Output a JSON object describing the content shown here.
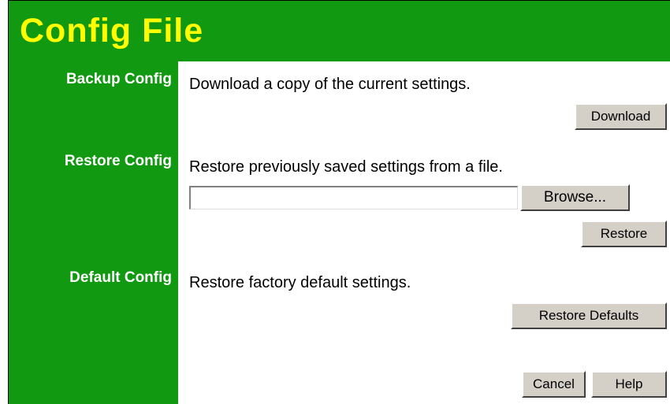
{
  "header": {
    "title": "Config File"
  },
  "sections": {
    "backup": {
      "label": "Backup Config",
      "description": "Download a copy of the current settings.",
      "button_label": "Download"
    },
    "restore": {
      "label": "Restore Config",
      "description": "Restore previously saved settings from a file.",
      "file_value": "",
      "browse_label": "Browse...",
      "button_label": "Restore"
    },
    "default": {
      "label": "Default Config",
      "description": "Restore factory default settings.",
      "button_label": "Restore Defaults"
    }
  },
  "footer": {
    "cancel_label": "Cancel",
    "help_label": "Help"
  },
  "colors": {
    "brand_green": "#119911",
    "title_yellow": "#ffff00",
    "button_face": "#d4d0c8"
  }
}
